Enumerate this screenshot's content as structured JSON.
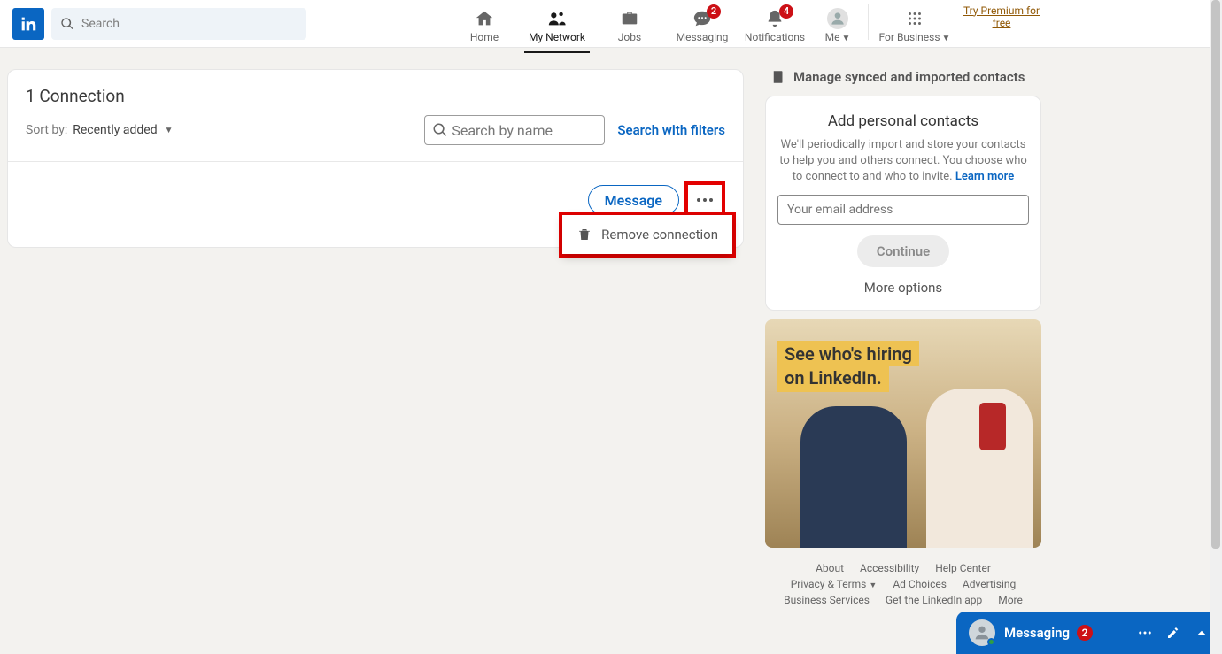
{
  "header": {
    "search_placeholder": "Search",
    "nav": {
      "home": "Home",
      "network": "My Network",
      "jobs": "Jobs",
      "messaging": "Messaging",
      "notifications": "Notifications",
      "me": "Me",
      "business": "For Business"
    },
    "badges": {
      "messaging": "2",
      "notifications": "4"
    },
    "premium": "Try Premium for free"
  },
  "connections": {
    "title": "1 Connection",
    "sort_label": "Sort by:",
    "sort_value": "Recently added",
    "search_name_placeholder": "Search by name",
    "search_filters": "Search with filters",
    "message_btn": "Message",
    "remove_label": "Remove connection"
  },
  "right": {
    "manage": "Manage synced and imported contacts",
    "add_title": "Add personal contacts",
    "add_sub": "We'll periodically import and store your contacts to help you and others connect. You choose who to connect to and who to invite. ",
    "learn_more": "Learn more",
    "email_placeholder": "Your email address",
    "continue": "Continue",
    "more_options": "More options",
    "ad_line1": "See who's hiring",
    "ad_line2": "on LinkedIn."
  },
  "footer": {
    "about": "About",
    "accessibility": "Accessibility",
    "help": "Help Center",
    "privacy": "Privacy & Terms",
    "adchoices": "Ad Choices",
    "advertising": "Advertising",
    "bizserv": "Business Services",
    "getapp": "Get the LinkedIn app",
    "more": "More"
  },
  "dock": {
    "title": "Messaging",
    "badge": "2"
  }
}
